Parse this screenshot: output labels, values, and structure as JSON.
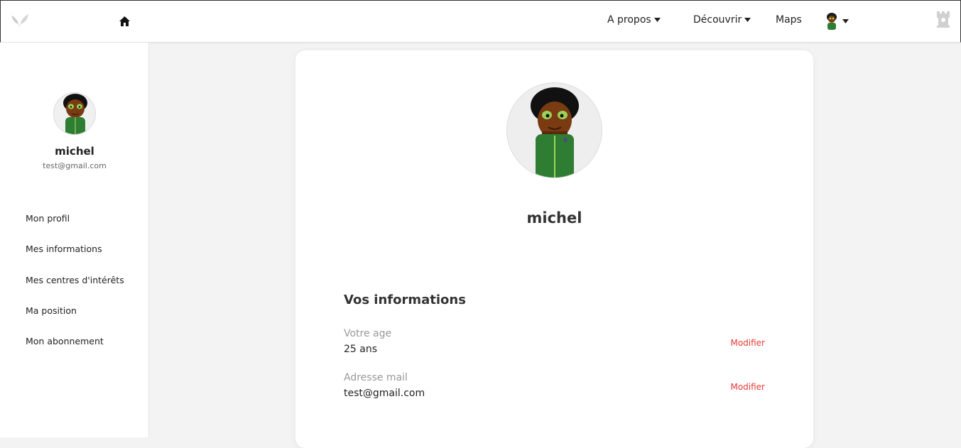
{
  "header": {
    "logo_icon": "leaf-logo-icon",
    "home_icon": "home-icon",
    "nav": [
      {
        "label": "A propos",
        "has_dropdown": true
      },
      {
        "label": "Découvrir",
        "has_dropdown": true
      },
      {
        "label": "Maps",
        "has_dropdown": false
      }
    ],
    "user_menu_icon": "avatar-icon",
    "right_icon": "castle-icon"
  },
  "sidebar": {
    "name": "michel",
    "email": "test@gmail.com",
    "items": [
      {
        "label": "Mon profil"
      },
      {
        "label": "Mes informations"
      },
      {
        "label": "Mes centres d'intérêts"
      },
      {
        "label": "Ma position"
      },
      {
        "label": "Mon abonnement"
      }
    ]
  },
  "profile": {
    "name": "michel",
    "section_title": "Vos informations",
    "fields": [
      {
        "label": "Votre age",
        "value": "25 ans",
        "action": "Modifier"
      },
      {
        "label": "Adresse mail",
        "value": "test@gmail.com",
        "action": "Modifier"
      }
    ]
  },
  "colors": {
    "accent_red": "#e53935",
    "jacket_green": "#2e7d32",
    "background": "#f3f3f3"
  }
}
